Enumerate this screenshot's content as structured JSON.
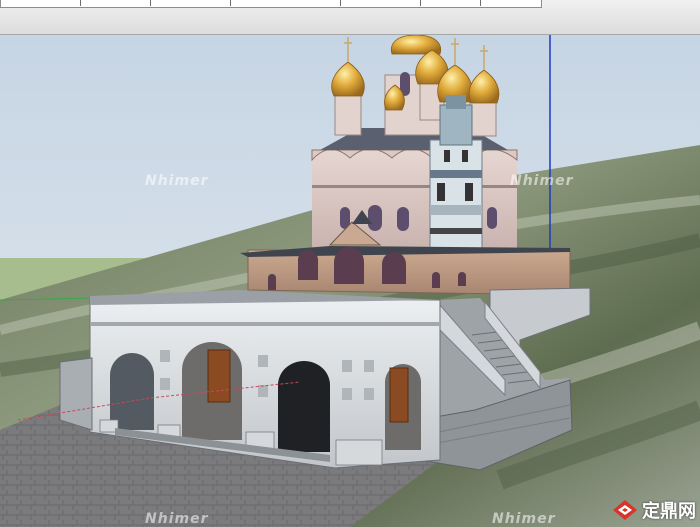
{
  "toolbar": {
    "partially_visible": true
  },
  "scene": {
    "subject": "Orthodox church 3D model",
    "watermarks": [
      "Nhimer",
      "Nhimer",
      "Nhimer",
      "Nhimer"
    ]
  },
  "brand": {
    "name": "定鼎网",
    "url": "www.dingding.com"
  },
  "colors": {
    "sky": "#d3dfe9",
    "axis_blue": "#1e3bbf",
    "axis_green": "#3aa84a",
    "gold": "#d9a23a"
  }
}
